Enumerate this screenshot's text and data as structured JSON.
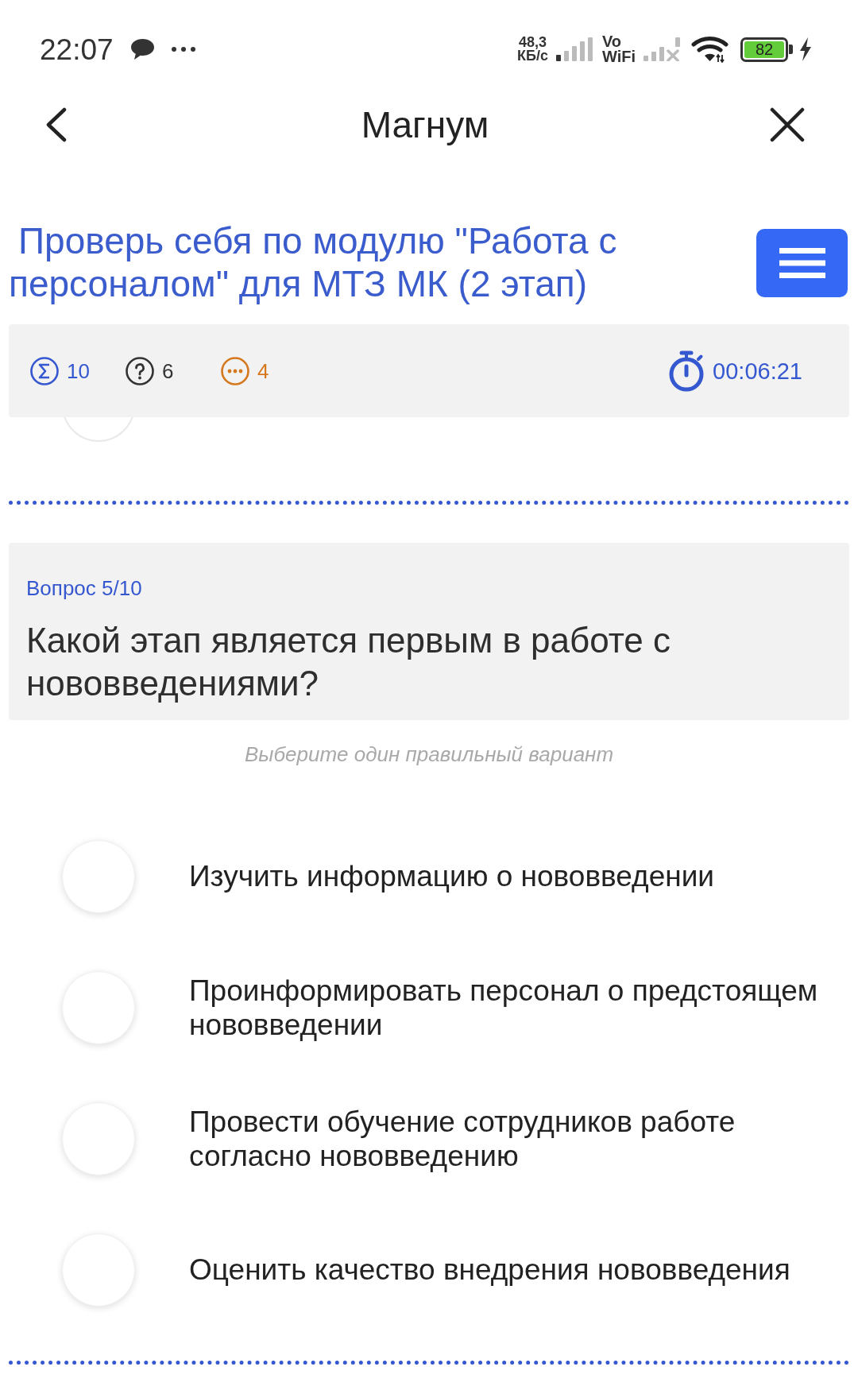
{
  "status_bar": {
    "time": "22:07",
    "network_speed": "48,3",
    "network_speed_unit": "КБ/с",
    "wifi_calling": {
      "line_1": "Vo",
      "line_2": "WiFi"
    },
    "battery": "82"
  },
  "header": {
    "title": "Магнум"
  },
  "test": {
    "title": "Проверь себя по модулю \"Работа с персоналом\" для МТЗ МК (2 этап)"
  },
  "stats": [
    {
      "kind": "sigma",
      "value": "10",
      "color": "#3558d0"
    },
    {
      "kind": "question",
      "value": "6",
      "color": "#333333"
    },
    {
      "kind": "dots",
      "value": "4",
      "color": "#d5771c"
    }
  ],
  "timer": {
    "value": "00:06:21"
  },
  "options_above": [
    {
      "selected": false
    }
  ],
  "question": {
    "counter": "Вопрос 5/10",
    "text": "Какой этап является первым в работе с нововведениями?",
    "hint": "Выберите один правильный вариант"
  },
  "options": [
    {
      "label": "Изучить информацию о нововведении",
      "selected": false
    },
    {
      "label": "Проинформировать персонал о предстоящем нововведении",
      "selected": false
    },
    {
      "label": "Провести обучение сотрудников работе согласно нововведению",
      "selected": false
    },
    {
      "label": "Оценить качество внедрения нововведения",
      "selected": false
    }
  ]
}
